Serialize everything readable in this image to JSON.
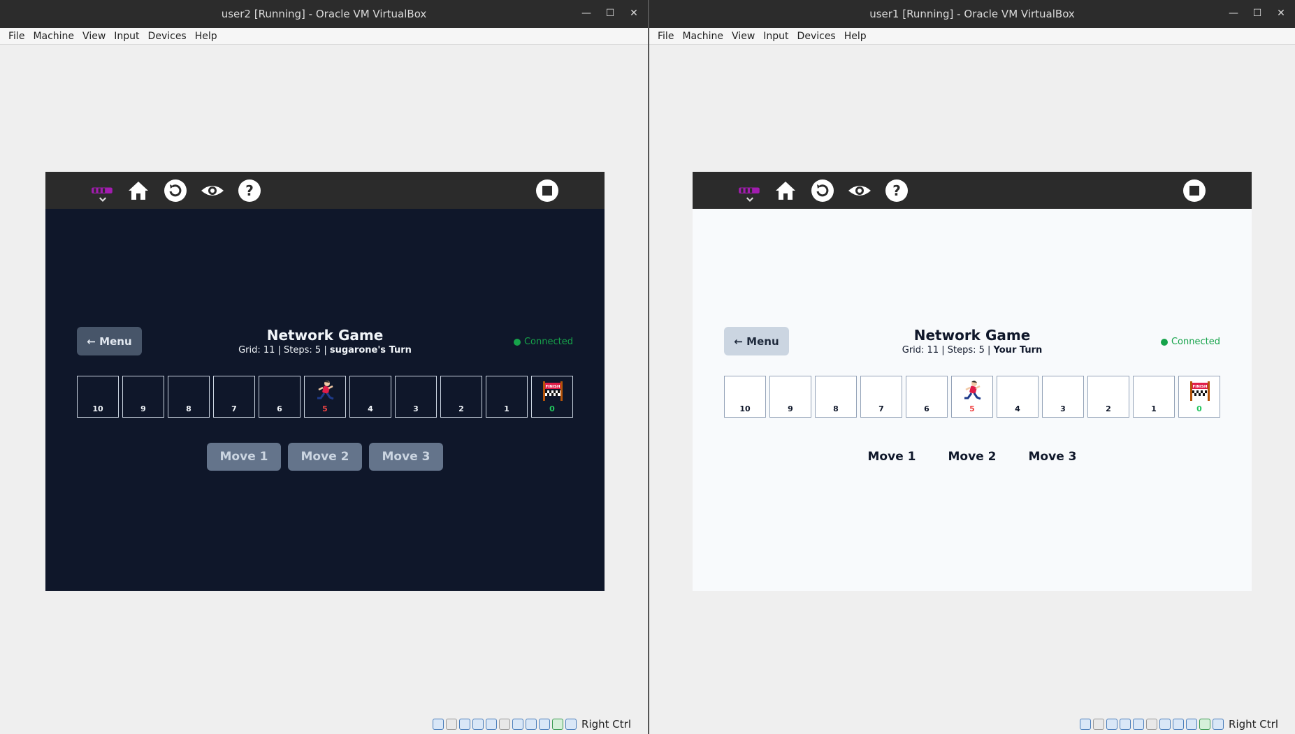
{
  "windows": {
    "left": {
      "title": "user2 [Running] - Oracle VM VirtualBox",
      "menus": [
        "File",
        "Machine",
        "View",
        "Input",
        "Devices",
        "Help"
      ],
      "host_key": "Right Ctrl",
      "game": {
        "menu_button": "← Menu",
        "title": "Network Game",
        "subtitle_prefix": "Grid: 11 | Steps: 5 | ",
        "turn_text": "sugarone's Turn",
        "status": "Connected",
        "moves": [
          "Move 1",
          "Move 2",
          "Move 3"
        ],
        "theme": "dark"
      }
    },
    "right": {
      "title": "user1 [Running] - Oracle VM VirtualBox",
      "menus": [
        "File",
        "Machine",
        "View",
        "Input",
        "Devices",
        "Help"
      ],
      "host_key": "Right Ctrl",
      "game": {
        "menu_button": "← Menu",
        "title": "Network Game",
        "subtitle_prefix": "Grid: 11 | Steps: 5 | ",
        "turn_text": "Your Turn",
        "status": "Connected",
        "moves": [
          "Move 1",
          "Move 2",
          "Move 3"
        ],
        "theme": "light"
      }
    }
  },
  "board": {
    "cells": [
      "10",
      "9",
      "8",
      "7",
      "6",
      "5",
      "4",
      "3",
      "2",
      "1",
      "0"
    ],
    "player_position": "5",
    "finish_position": "0",
    "finish_label": "FINISH"
  },
  "window_controls": [
    "minimize",
    "maximize",
    "close"
  ],
  "colors": {
    "connected": "#16a34a",
    "player_cell_number": "#ef4444",
    "finish_cell_number": "#22c55e"
  }
}
